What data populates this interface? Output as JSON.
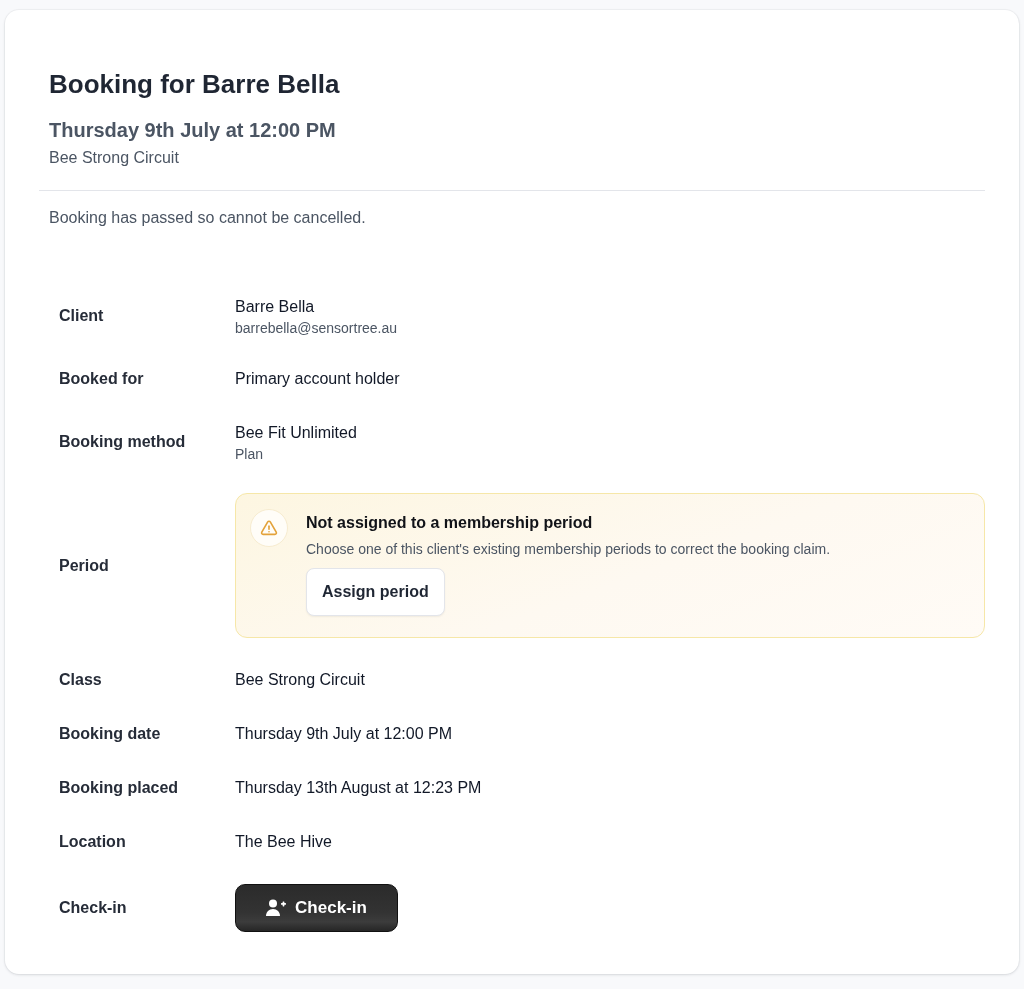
{
  "header": {
    "title": "Booking for Barre Bella",
    "date": "Thursday 9th July at 12:00 PM",
    "class_name": "Bee Strong Circuit"
  },
  "notice": "Booking has passed so cannot be cancelled.",
  "details": [
    {
      "kind": "text",
      "label": "Client",
      "value": "Barre Bella",
      "secondary": "barrebella@sensortree.au"
    },
    {
      "kind": "text",
      "label": "Booked for",
      "value": "Primary account holder"
    },
    {
      "kind": "text",
      "label": "Booking method",
      "value": "Bee Fit Unlimited",
      "secondary": "Plan"
    },
    {
      "kind": "alert",
      "label": "Period",
      "alert": {
        "title": "Not assigned to a membership period",
        "message": "Choose one of this client's existing membership periods to correct the booking claim.",
        "button": "Assign period"
      }
    },
    {
      "kind": "text",
      "label": "Class",
      "value": "Bee Strong Circuit"
    },
    {
      "kind": "text",
      "label": "Booking date",
      "value": "Thursday 9th July at 12:00 PM"
    },
    {
      "kind": "text",
      "label": "Booking placed",
      "value": "Thursday 13th August at 12:23 PM"
    },
    {
      "kind": "text",
      "label": "Location",
      "value": "The Bee Hive"
    },
    {
      "kind": "button",
      "label": "Check-in",
      "button": "Check-in"
    }
  ]
}
